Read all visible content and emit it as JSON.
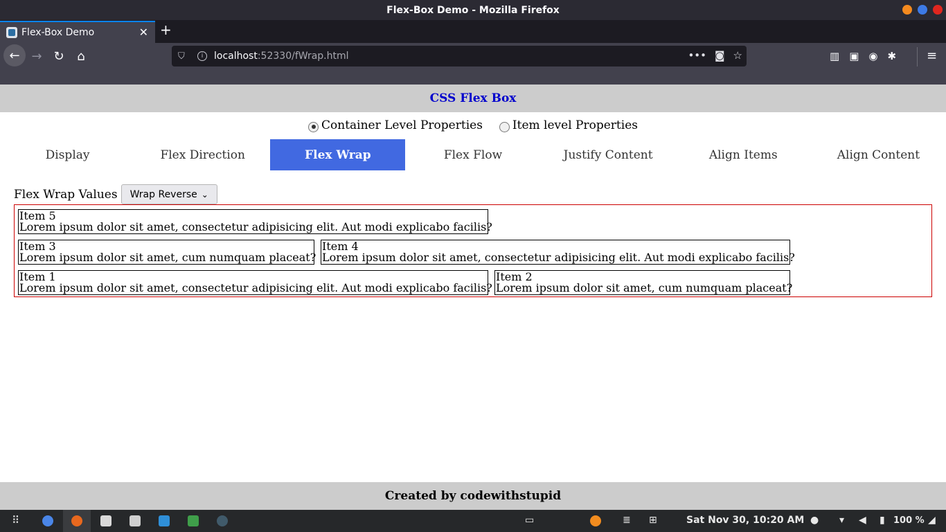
{
  "window": {
    "title": "Flex-Box Demo - Mozilla Firefox"
  },
  "browser": {
    "tab_title": "Flex-Box Demo",
    "url_host": "localhost",
    "url_rest": ":52330/fWrap.html"
  },
  "page": {
    "header": "CSS Flex Box",
    "radios": [
      {
        "label": "Container Level Properties",
        "checked": true
      },
      {
        "label": "Item level Properties",
        "checked": false
      }
    ],
    "tabs": [
      "Display",
      "Flex Direction",
      "Flex Wrap",
      "Flex Flow",
      "Justify Content",
      "Align Items",
      "Align Content"
    ],
    "active_tab": "Flex Wrap",
    "control_label": "Flex Wrap Values",
    "select_value": "Wrap Reverse",
    "items": [
      {
        "name": "Item 5",
        "text": "Lorem ipsum dolor sit amet, consectetur adipisicing elit. Aut modi explicabo facilis?"
      },
      {
        "name": "Item 3",
        "text": "Lorem ipsum dolor sit amet, cum numquam placeat?"
      },
      {
        "name": "Item 4",
        "text": "Lorem ipsum dolor sit amet, consectetur adipisicing elit. Aut modi explicabo facilis?"
      },
      {
        "name": "Item 1",
        "text": "Lorem ipsum dolor sit amet, consectetur adipisicing elit. Aut modi explicabo facilis?"
      },
      {
        "name": "Item 2",
        "text": "Lorem ipsum dolor sit amet, cum numquam placeat?"
      }
    ],
    "footer": "Created by codewithstupid",
    "accent_color": "#4169e1",
    "header_color": "#0000cd"
  },
  "taskbar": {
    "clock": "Sat Nov 30, 10:20 AM",
    "battery": "100 %"
  }
}
